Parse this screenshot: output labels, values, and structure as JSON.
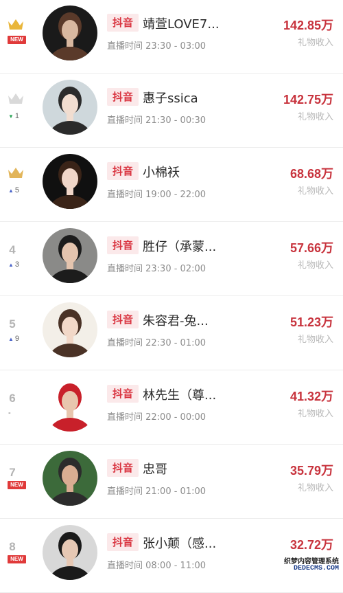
{
  "rows": [
    {
      "rank": "",
      "change": "",
      "is_new": true,
      "crown": "gold",
      "platform": "抖音",
      "name": "靖萱LOVE7...",
      "time": "直播时间 23:30 - 03:00",
      "amount": "142.85万",
      "income_label": "礼物收入",
      "avatar_colors": [
        "#1a1a1a",
        "#5a3a2a",
        "#d8b8a0"
      ]
    },
    {
      "rank": "",
      "change": "1",
      "change_dir": "down",
      "is_new": false,
      "crown": "silver",
      "platform": "抖音",
      "name": "惠子ssica",
      "time": "直播时间 21:30 - 00:30",
      "amount": "142.75万",
      "income_label": "礼物收入",
      "avatar_colors": [
        "#cfd8dc",
        "#2b2b2b",
        "#f1ddd0"
      ]
    },
    {
      "rank": "",
      "change": "5",
      "change_dir": "up",
      "is_new": false,
      "crown": "bronze",
      "platform": "抖音",
      "name": "小棉袄",
      "time": "直播时间 19:00 - 22:00",
      "amount": "68.68万",
      "income_label": "礼物收入",
      "avatar_colors": [
        "#101010",
        "#3a2418",
        "#f0d6c8"
      ]
    },
    {
      "rank": "4",
      "change": "3",
      "change_dir": "up",
      "is_new": false,
      "crown": "",
      "platform": "抖音",
      "name": "胜仔（承蒙...",
      "time": "直播时间 23:30 - 02:00",
      "amount": "57.66万",
      "income_label": "礼物收入",
      "avatar_colors": [
        "#8a8a88",
        "#1c1c1c",
        "#e4c4ae"
      ]
    },
    {
      "rank": "5",
      "change": "9",
      "change_dir": "up",
      "is_new": false,
      "crown": "",
      "platform": "抖音",
      "name": "朱容君-兔...",
      "time": "直播时间 22:30 - 01:00",
      "amount": "51.23万",
      "income_label": "礼物收入",
      "avatar_colors": [
        "#f3efe8",
        "#4a3226",
        "#f2d8c8"
      ]
    },
    {
      "rank": "6",
      "change": "-",
      "change_dir": "none",
      "is_new": false,
      "crown": "",
      "platform": "抖音",
      "name": "林先生（尊...",
      "time": "直播时间 22:00 - 00:00",
      "amount": "41.32万",
      "income_label": "礼物收入",
      "avatar_colors": [
        "#ffffff",
        "#c8202a",
        "#e8c6ae"
      ]
    },
    {
      "rank": "7",
      "change": "",
      "is_new": true,
      "crown": "",
      "platform": "抖音",
      "name": "忠哥",
      "time": "直播时间 21:00 - 01:00",
      "amount": "35.79万",
      "income_label": "礼物收入",
      "avatar_colors": [
        "#3c6a3a",
        "#2c2c2c",
        "#d9ad92"
      ]
    },
    {
      "rank": "8",
      "change": "",
      "is_new": true,
      "crown": "",
      "platform": "抖音",
      "name": "张小颠（感...",
      "time": "直播时间 08:00 - 11:00",
      "amount": "32.72万",
      "income_label": "",
      "avatar_colors": [
        "#d8d8d8",
        "#1a1a1a",
        "#e6c8b4"
      ]
    }
  ],
  "new_label": "NEW",
  "watermark": {
    "line1": "织梦内容管理系统",
    "line2": "DEDECMS.COM"
  }
}
